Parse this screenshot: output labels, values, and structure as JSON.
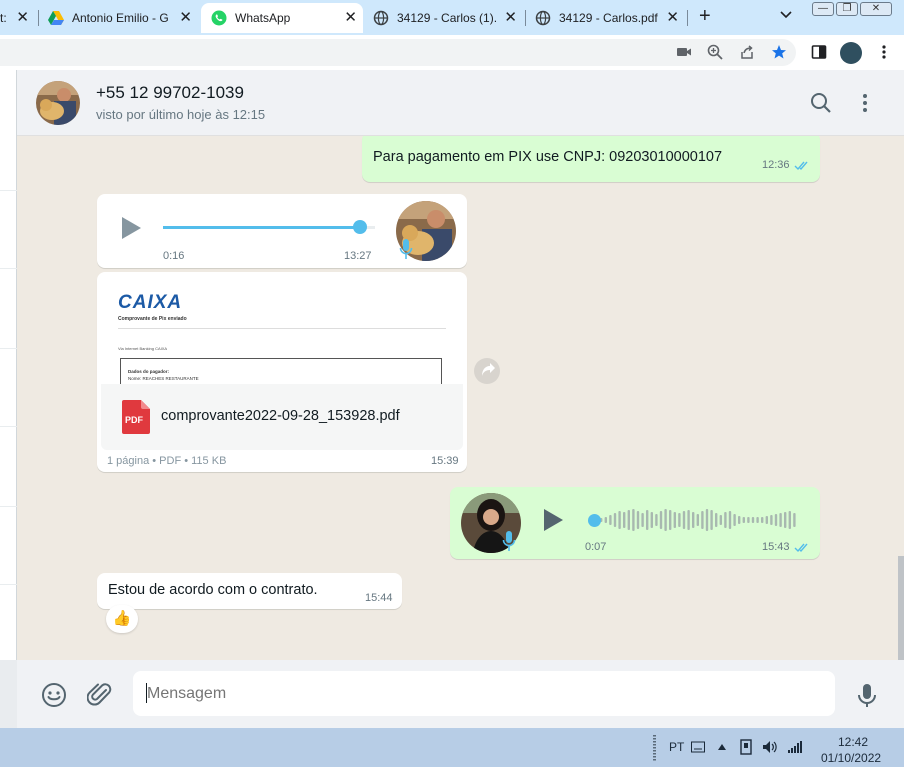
{
  "browser": {
    "tabs": [
      {
        "title": "t:",
        "partial": true
      },
      {
        "title": "Antonio Emilio - G",
        "favicon": "google-drive-icon"
      },
      {
        "title": "WhatsApp",
        "favicon": "whatsapp-icon",
        "active": true
      },
      {
        "title": "34129 - Carlos (1).",
        "favicon": "globe-icon"
      },
      {
        "title": "34129 - Carlos.pdf",
        "favicon": "globe-icon"
      }
    ],
    "new_tab_label": "+",
    "close_glyph": "✕"
  },
  "chat": {
    "contact_name": "+55 12 99702-1039",
    "contact_status": "visto por último hoje às 12:15",
    "messages": [
      {
        "type": "text",
        "direction": "out",
        "text": "Para pagamento em PIX use CNPJ: 09203010000107",
        "time": "12:36",
        "read": true
      },
      {
        "type": "audio",
        "direction": "in",
        "elapsed": "0:16",
        "time": "13:27",
        "progress": 0.93
      },
      {
        "type": "document",
        "direction": "in",
        "preview_brand": "CAIXA",
        "preview_title": "Comprovante de Pix enviado",
        "preview_subtitle": "Via Internet Banking CAIXA",
        "preview_section": "Dados do pagador:",
        "preview_name_line": "Nome: REACHES RESTAURANTE",
        "file_type_label": "PDF",
        "file_name": "comprovante2022-09-28_153928.pdf",
        "file_info": "1 página • PDF • 115 KB",
        "time": "15:39"
      },
      {
        "type": "audio",
        "direction": "out",
        "elapsed": "0:07",
        "time": "15:43",
        "progress": 0.0,
        "read": true
      },
      {
        "type": "text",
        "direction": "in",
        "text": "Estou de acordo com o contrato.",
        "time": "15:44",
        "reaction": "👍"
      }
    ]
  },
  "composer": {
    "placeholder": "Mensagem"
  },
  "taskbar": {
    "language": "PT",
    "time": "12:42",
    "date": "01/10/2022"
  },
  "colors": {
    "outgoing_bubble": "#d9fdd3",
    "incoming_bubble": "#ffffff",
    "chat_background": "#efeae2",
    "accent_blue": "#53bdeb",
    "read_ticks": "#53bdeb",
    "caixa_blue": "#1c5aa6",
    "caixa_orange": "#f39200",
    "pdf_red": "#e0393e"
  }
}
